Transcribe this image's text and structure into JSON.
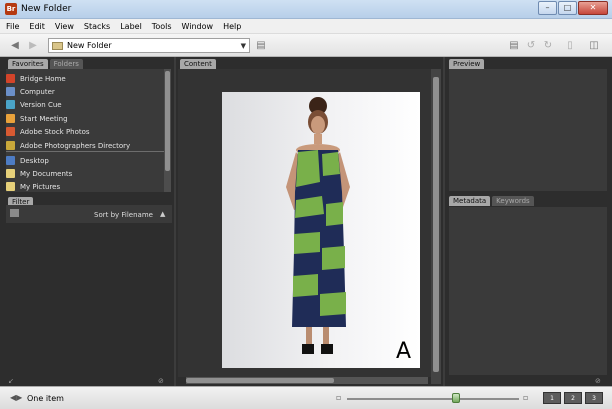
{
  "window": {
    "title": "New Folder",
    "app_icon_text": "Br"
  },
  "menu": [
    "File",
    "Edit",
    "View",
    "Stacks",
    "Label",
    "Tools",
    "Window",
    "Help"
  ],
  "path": {
    "value": "New Folder"
  },
  "panels": {
    "left_tabs": [
      "Favorites",
      "Folders"
    ],
    "content_tab": "Content",
    "preview_tab": "Preview",
    "filter_tab": "Filter",
    "metadata_tabs": [
      "Metadata",
      "Keywords"
    ]
  },
  "favorites": [
    {
      "label": "Bridge Home",
      "icon_color": "#d3442a"
    },
    {
      "label": "Computer",
      "icon_color": "#6b8fc8"
    },
    {
      "label": "Version Cue",
      "icon_color": "#4aa4c8"
    },
    {
      "label": "Start Meeting",
      "icon_color": "#e9a23b"
    },
    {
      "label": "Adobe Stock Photos",
      "icon_color": "#d85a32"
    },
    {
      "label": "Adobe Photographers Directory",
      "icon_color": "#c9a83a"
    },
    {
      "label": "Desktop",
      "icon_color": "#4d7cc4"
    },
    {
      "label": "My Documents",
      "icon_color": "#e6d07a"
    },
    {
      "label": "My Pictures",
      "icon_color": "#e6d07a"
    }
  ],
  "filter": {
    "sort_label": "Sort by Filename"
  },
  "photo": {
    "corner_letter": "A"
  },
  "status": {
    "text": "One item"
  },
  "view_buttons": [
    "1",
    "2",
    "3"
  ],
  "colors": {
    "dress_green": "#79b04a",
    "dress_navy": "#1f2c57"
  }
}
